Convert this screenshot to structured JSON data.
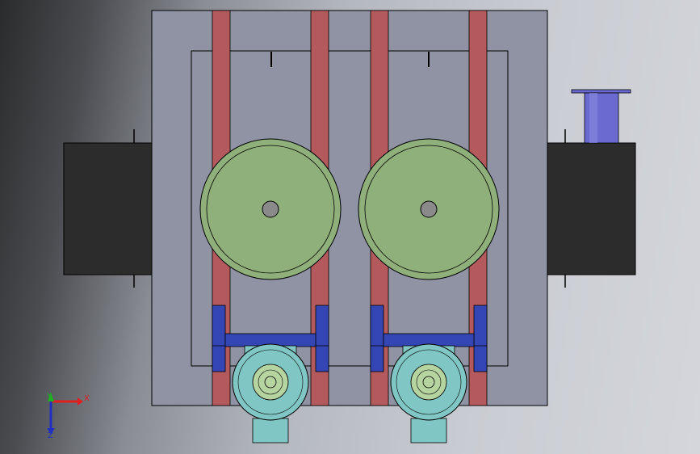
{
  "viewport": {
    "background_colors": [
      "#2a2b2c",
      "#8a8d94",
      "#c9ccd2",
      "#d4d6db"
    ]
  },
  "model": {
    "frame_color": "#8f93a4",
    "rail_color": "#b45a5c",
    "drum_color": "#8fb07a",
    "hub_color": "#8a8a8a",
    "bracket_color": "#3346b4",
    "motor_color": "#7fc6c4",
    "motor_inner_color": "#b5d4a0",
    "side_block_color": "#2c2c2c",
    "pipe_color": "#6a6ad0",
    "drums": 2,
    "motors": 2
  },
  "triad": {
    "x_label": "X",
    "y_label": "Y",
    "z_label": "Z",
    "x_color": "#e02020",
    "y_color": "#20b020",
    "z_color": "#2030c0",
    "icon": "axis-triad-icon"
  }
}
